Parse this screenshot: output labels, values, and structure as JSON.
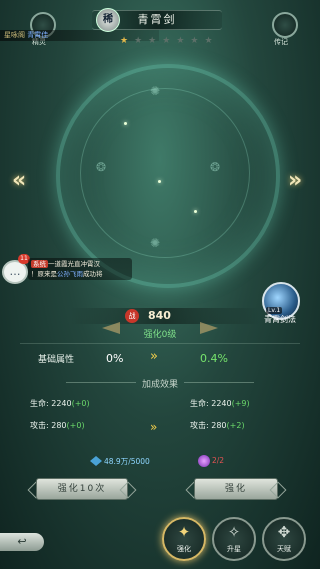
{
  "header": {
    "title": "青霄剑",
    "grade_badge": "稀",
    "left_label": "精灵",
    "right_label": "传记",
    "stars_total": 7,
    "stars_on": 1,
    "ticker_prefix": "星咏阁",
    "ticker_name": "青霄佳"
  },
  "chat": {
    "badge": "11",
    "system_tag": "系统",
    "line1": "一道霞光直冲霄汉",
    "line2_a": "！原来是",
    "line2_name": "公孙飞雨",
    "line2_b": "成功将"
  },
  "skill": {
    "level": "Lv.1",
    "name": "青霄剑法"
  },
  "power": {
    "badge": "战",
    "value": "840",
    "level_text": "强化0级"
  },
  "base_attr": {
    "label": "基础属性",
    "from": "0%",
    "to": "0.4%"
  },
  "bonus": {
    "title": "加成效果",
    "left": [
      {
        "label": "生命:",
        "value": "2240",
        "plus": "(+0)"
      },
      {
        "label": "攻击:",
        "value": "280",
        "plus": "(+0)"
      }
    ],
    "right": [
      {
        "label": "生命:",
        "value": "2240",
        "plus": "(+9)"
      },
      {
        "label": "攻击:",
        "value": "280",
        "plus": "(+2)"
      }
    ]
  },
  "resources": {
    "a": "48.9万/5000",
    "b": "2/2"
  },
  "buttons": {
    "ten": "强化10次",
    "one": "强化"
  },
  "nav": [
    {
      "label": "强化",
      "glyph": "✦",
      "active": true
    },
    {
      "label": "升星",
      "glyph": "✧",
      "active": false
    },
    {
      "label": "天赋",
      "glyph": "✥",
      "active": false
    }
  ],
  "colors": {
    "positive": "#77e46c",
    "accent_gold": "#d6b865",
    "warning_red": "#e65353"
  },
  "icons": [
    "back-arrow-icon",
    "chat-icon",
    "sword-skill-icon",
    "double-chevron-right-icon"
  ]
}
